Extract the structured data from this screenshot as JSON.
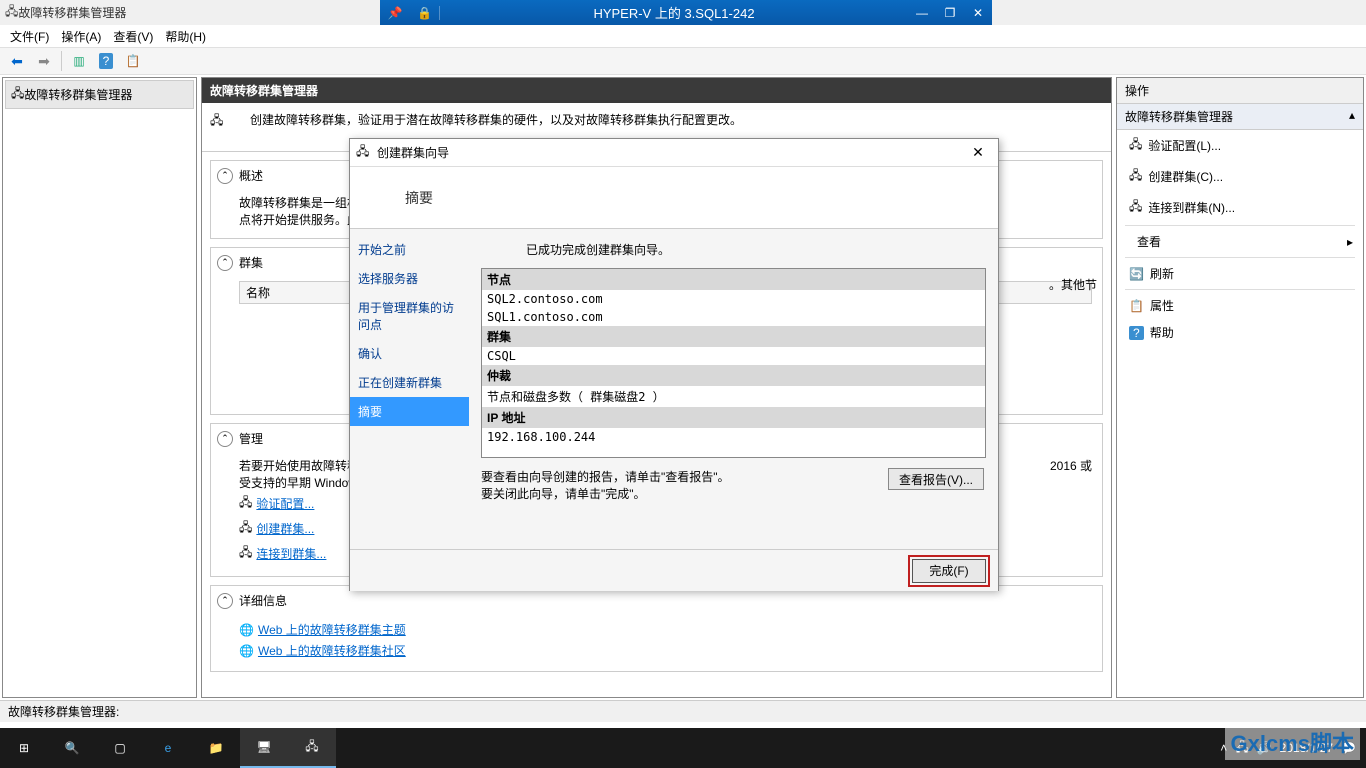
{
  "outer_window": {
    "minimize": "—",
    "maximize": "☐",
    "close": "✕"
  },
  "vm_titlebar": {
    "title": "HYPER-V 上的 3.SQL1-242"
  },
  "app": {
    "title": "故障转移群集管理器",
    "menus": [
      "文件(F)",
      "操作(A)",
      "查看(V)",
      "帮助(H)"
    ],
    "status": "故障转移群集管理器:"
  },
  "tree": {
    "root": "故障转移群集管理器"
  },
  "content": {
    "header": "故障转移群集管理器",
    "desc": "创建故障转移群集，验证用于潜在故障转移群集的硬件，以及对故障转移群集执行配置更改。",
    "overview": {
      "title": "概述",
      "body_prefix": "故障转移群集是一组相互",
      "body_suffix": "点将开始提供服务。此过"
    },
    "other_suffix": "。其他节",
    "clusters": {
      "title": "群集",
      "col_name": "名称"
    },
    "manage": {
      "title": "管理",
      "line1_prefix": "若要开始使用故障转移群",
      "line1_suffix": "2016 或",
      "line2": "受支持的早期 Windows S",
      "links": [
        "验证配置...",
        "创建群集...",
        "连接到群集..."
      ]
    },
    "details": {
      "title": "详细信息",
      "links": [
        "Web 上的故障转移群集主题",
        "Web 上的故障转移群集社区"
      ]
    }
  },
  "actions": {
    "header": "操作",
    "group": "故障转移群集管理器",
    "items": [
      "验证配置(L)...",
      "创建群集(C)...",
      "连接到群集(N)..."
    ],
    "view": "查看",
    "refresh": "刷新",
    "properties": "属性",
    "help": "帮助"
  },
  "wizard": {
    "title": "创建群集向导",
    "banner": "摘要",
    "nav": [
      "开始之前",
      "选择服务器",
      "用于管理群集的访问点",
      "确认",
      "正在创建新群集",
      "摘要"
    ],
    "message": "已成功完成创建群集向导。",
    "summary": {
      "node_h": "节点",
      "node1": "SQL2.contoso.com",
      "node2": "SQL1.contoso.com",
      "cluster_h": "群集",
      "cluster_v": "CSQL",
      "quorum_h": "仲裁",
      "quorum_v": "节点和磁盘多数（ 群集磁盘2 ）",
      "ip_h": "IP 地址",
      "ip_v": "192.168.100.244"
    },
    "report_text1": "要查看由向导创建的报告，请单击\"查看报告\"。",
    "report_text2": "要关闭此向导，请单击\"完成\"。",
    "report_btn": "查看报告(V)...",
    "finish_btn": "完成(F)"
  },
  "taskbar": {
    "date": "2018/1/27"
  },
  "watermark": "Gxlcms脚本"
}
